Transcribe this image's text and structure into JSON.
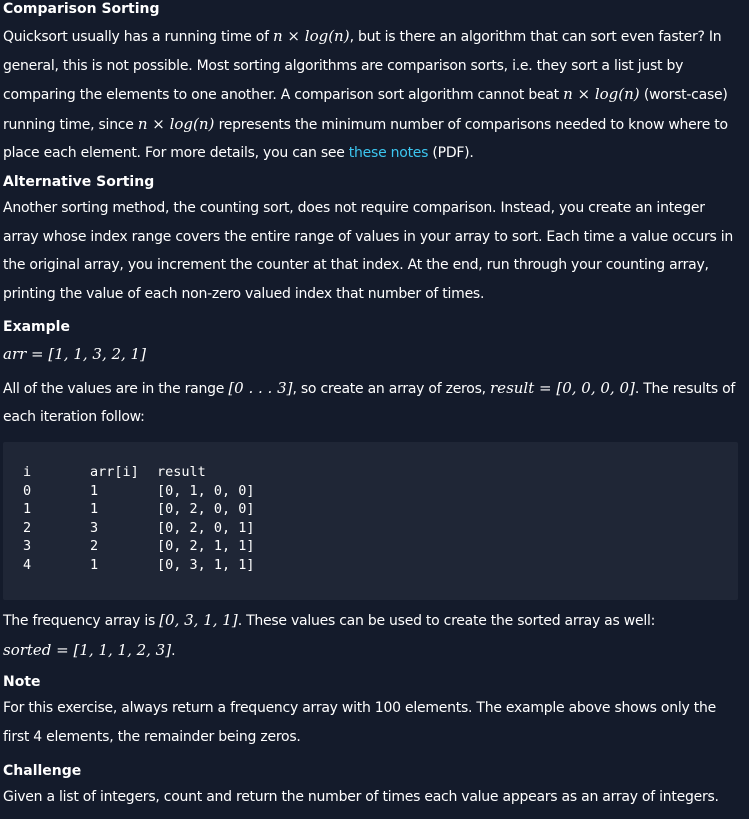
{
  "sections": {
    "comparison": {
      "heading": "Comparison Sorting",
      "p_part1": "Quicksort usually has a running time of ",
      "math1": "n × log(n)",
      "p_part2": ", but is there an algorithm that can sort even faster? In general, this is not possible. Most sorting algorithms are comparison sorts, i.e. they sort a list just by comparing the elements to one another. A comparison sort algorithm cannot beat ",
      "math2": "n × log(n)",
      "p_part3": " (worst-case) running time, since ",
      "math3": "n × log(n)",
      "p_part4": " represents the minimum number of comparisons needed to know where to place each element. For more details, you can see ",
      "link_text": "these notes",
      "p_part5": " (PDF)."
    },
    "alternative": {
      "heading": "Alternative Sorting",
      "text": "Another sorting method, the counting sort, does not require comparison. Instead, you create an integer array whose index range covers the entire range of values in your array to sort. Each time a value occurs in the original array, you increment the counter at that index. At the end, run through your counting array, printing the value of each non-zero valued index that number of times."
    },
    "example": {
      "heading": "Example",
      "arr_math": "arr = [1, 1, 3, 2, 1]",
      "range_part1": "All of the values are in the range ",
      "range_math": "[0 . . . 3]",
      "range_part2": ", so create an array of zeros, ",
      "result_math": "result = [0, 0, 0, 0]",
      "range_part3": ". The results of each iteration follow:",
      "code": {
        "header": [
          "i",
          "arr[i]",
          "result"
        ],
        "rows": [
          [
            "0",
            "1",
            "[0, 1, 0, 0]"
          ],
          [
            "1",
            "1",
            "[0, 2, 0, 0]"
          ],
          [
            "2",
            "3",
            "[0, 2, 0, 1]"
          ],
          [
            "3",
            "2",
            "[0, 2, 1, 1]"
          ],
          [
            "4",
            "1",
            "[0, 3, 1, 1]"
          ]
        ]
      },
      "freq_part1": "The frequency array is ",
      "freq_math": "[0, 3, 1, 1]",
      "freq_part2": ". These values can be used to create the sorted array as well:",
      "sorted_math": "sorted = [1, 1, 1, 2, 3]",
      "sorted_end": "."
    },
    "note": {
      "heading": "Note",
      "text": "For this exercise, always return a frequency array with 100 elements. The example above shows only the first 4 elements, the remainder being zeros."
    },
    "challenge": {
      "heading": "Challenge",
      "text": "Given a list of integers, count and return the number of times each value appears as an array of integers."
    }
  },
  "colors": {
    "background": "#141b2b",
    "code_background": "#1f2636",
    "text": "#ffffff",
    "link": "#3cc6f0"
  }
}
